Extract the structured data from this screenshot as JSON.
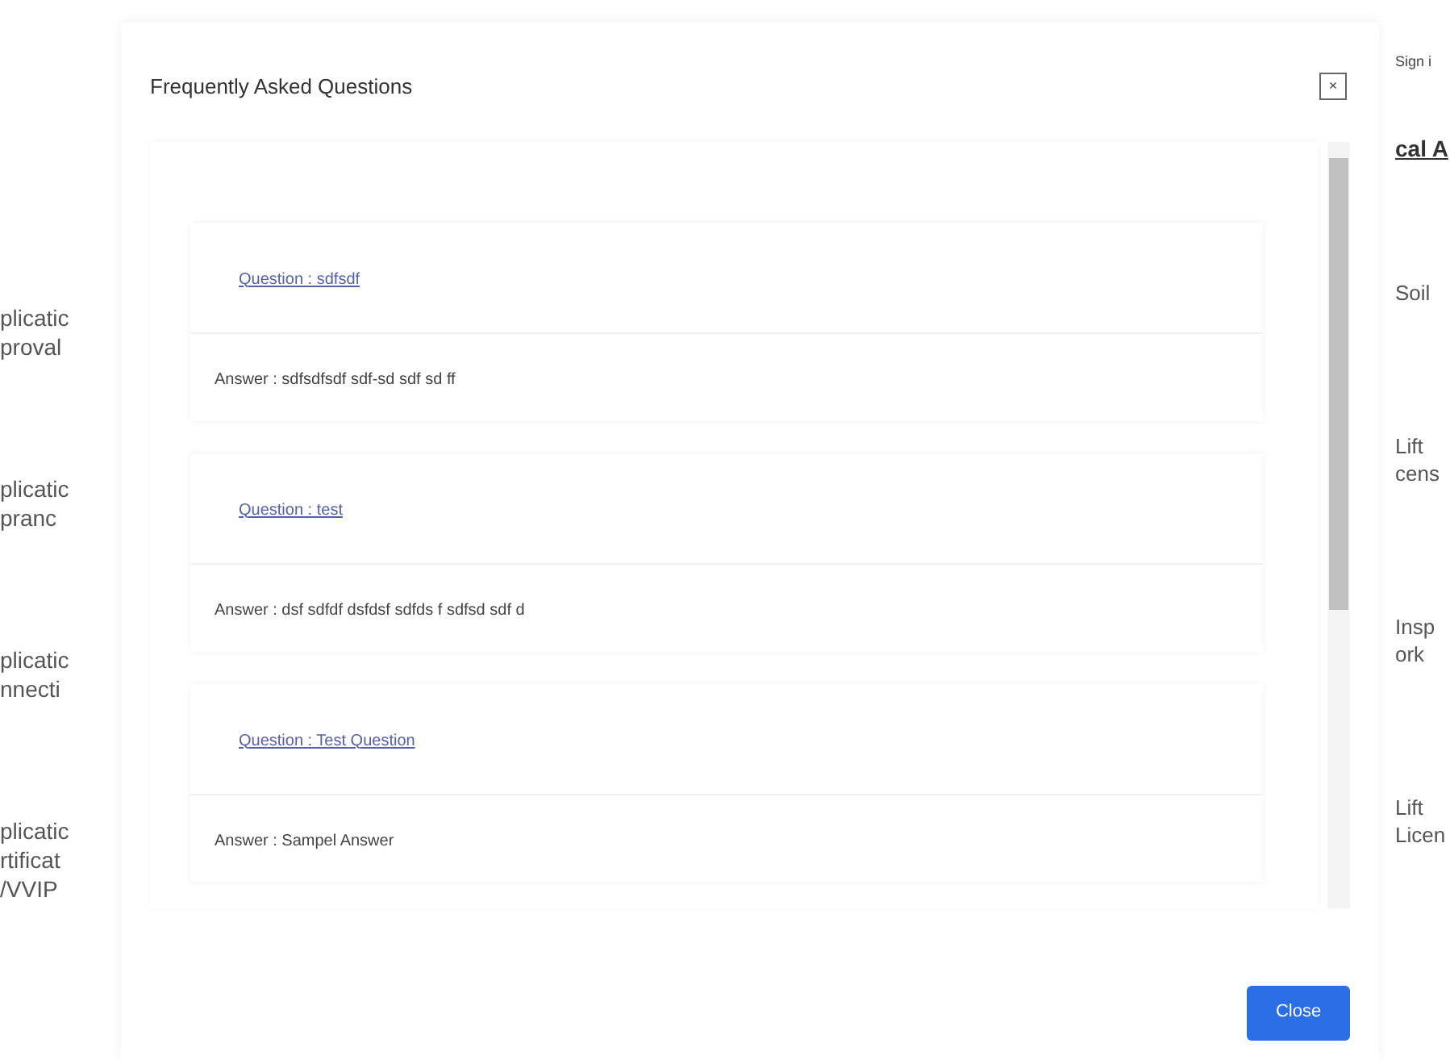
{
  "background_left": [
    "plicatic\nproval",
    "plicatic\npranc",
    "plicatic\nnnecti",
    "plicatic\nrtificat\n/VVIP"
  ],
  "background_right": {
    "header_link": "Sign i",
    "section_title": "cal A",
    "items": [
      "Soil",
      "Lift\ncens",
      "Insp\nork",
      "Lift\nLicen"
    ]
  },
  "dialog": {
    "title": "Frequently Asked Questions",
    "close_icon": "×",
    "faqs": [
      {
        "question": "Question : sdfsdf",
        "answer": "Answer : sdfsdfsdf sdf-sd sdf sd ff"
      },
      {
        "question": "Question : test",
        "answer": "Answer : dsf sdfdf dsfdsf sdfds f sdfsd sdf d"
      },
      {
        "question": "Question : Test Question",
        "answer": "Answer : Sampel Answer"
      }
    ],
    "close_button": "Close"
  }
}
